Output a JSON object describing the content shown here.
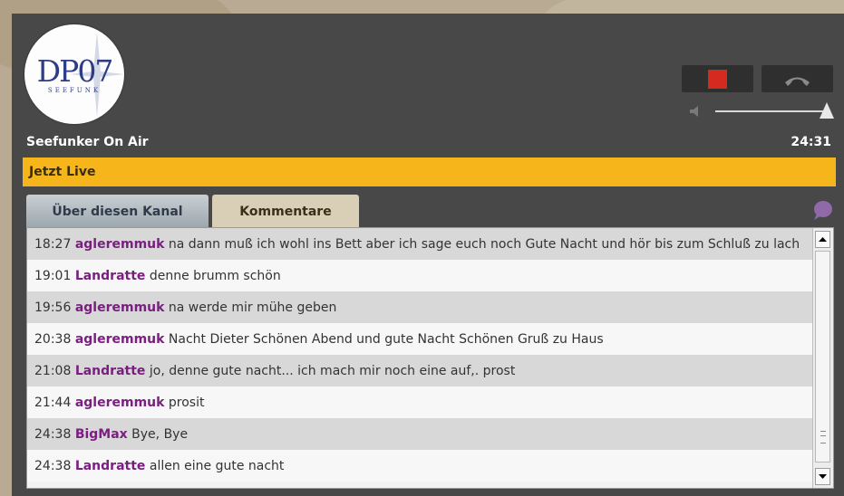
{
  "logo": {
    "text": "DP07",
    "subtitle": "SEEFUNK",
    "color": "#2d3d86"
  },
  "station": {
    "name": "Seefunker On Air",
    "time": "24:31"
  },
  "controls": {
    "stop_color": "#d42a1f",
    "volume_level": 1.0
  },
  "live": {
    "label": "Jetzt Live",
    "color": "#f5b51b"
  },
  "tabs": [
    {
      "label": "Über diesen Kanal",
      "active": false
    },
    {
      "label": "Kommentare",
      "active": true
    }
  ],
  "comments": [
    {
      "time": "18:27",
      "user": "agleremmuk",
      "text": "na dann muß ich wohl ins Bett  aber ich sage euch noch Gute Nacht und hör bis zum Schluß zu lach"
    },
    {
      "time": "19:01",
      "user": "Landratte",
      "text": "denne brumm schön"
    },
    {
      "time": "19:56",
      "user": "agleremmuk",
      "text": "na werde mir mühe geben"
    },
    {
      "time": "20:38",
      "user": "agleremmuk",
      "text": "Nacht  Dieter Schönen Abend und gute Nacht Schönen Gruß zu Haus"
    },
    {
      "time": "21:08",
      "user": "Landratte",
      "text": "jo, denne gute nacht... ich mach mir noch eine auf,. prost"
    },
    {
      "time": "21:44",
      "user": "agleremmuk",
      "text": "prosit"
    },
    {
      "time": "24:38",
      "user": "BigMax",
      "text": "Bye, Bye"
    },
    {
      "time": "24:38",
      "user": "Landratte",
      "text": "allen eine gute nacht"
    }
  ],
  "icons": [
    "stop-icon",
    "hangup-phone-icon",
    "volume-icon",
    "chat-bubble-icon",
    "scroll-up-icon",
    "scroll-down-icon"
  ]
}
